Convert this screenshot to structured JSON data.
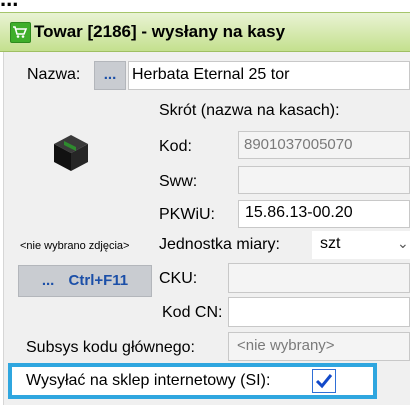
{
  "background_window": {
    "text": "..."
  },
  "window": {
    "title": "Towar [2186] - wysłany na kasy",
    "title_icon": "shopping-cart-icon"
  },
  "form": {
    "nazwa_label": "Nazwa:",
    "nazwa_button": "...",
    "nazwa_value": "Herbata Eternal 25 tor",
    "skrot_label": "Skrót (nazwa na kasach):",
    "kod_label": "Kod:",
    "kod_value": "8901037005070",
    "sww_label": "Sww:",
    "sww_value": "",
    "pkwiu_label": "PKWiU:",
    "pkwiu_value": "15.86.13-00.20",
    "no_image_text": "<nie wybrano zdjęcia>",
    "image_button_dots": "...",
    "image_button_shortcut": "Ctrl+F11",
    "jm_label": "Jednostka miary:",
    "jm_value": "szt",
    "cku_label": "CKU:",
    "cku_value": "",
    "kodcn_label": "Kod CN:",
    "kodcn_value": "",
    "subsys_label": "Subsys kodu głównego:",
    "subsys_value": "<nie wybrany>",
    "si_label": "Wysyłać na sklep internetowy (SI):",
    "si_checked": true
  },
  "colors": {
    "accent": "#2fa6df",
    "title_bar": "#c4e08e",
    "button_text": "#1b4fa8"
  }
}
